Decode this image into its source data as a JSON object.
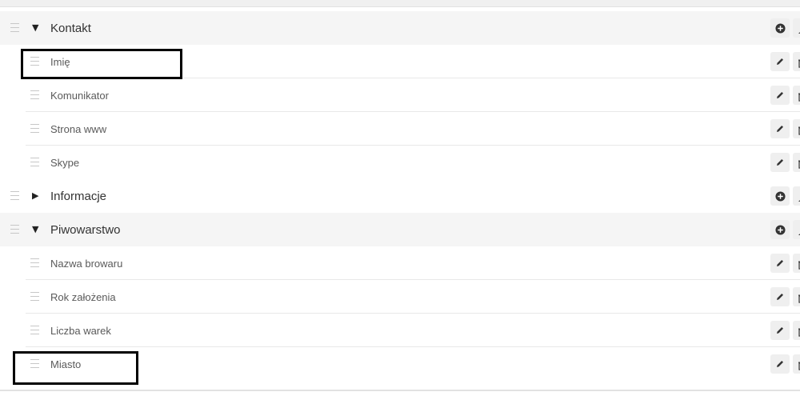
{
  "groups": [
    {
      "label": "Kontakt",
      "expanded": true,
      "toggle_icon": "▼",
      "fields": [
        {
          "label": "Imię"
        },
        {
          "label": "Komunikator"
        },
        {
          "label": "Strona www"
        },
        {
          "label": "Skype"
        }
      ]
    },
    {
      "label": "Informacje",
      "expanded": false,
      "toggle_icon": "▶",
      "fields": []
    },
    {
      "label": "Piwowarstwo",
      "expanded": true,
      "toggle_icon": "▼",
      "fields": [
        {
          "label": "Nazwa browaru"
        },
        {
          "label": "Rok założenia"
        },
        {
          "label": "Liczba warek"
        },
        {
          "label": "Miasto"
        }
      ]
    }
  ],
  "icons": {
    "drag": "drag-handle-icon",
    "group_action": "plus-circle-icon",
    "field_action": "pencil-icon",
    "second_action_group": "user-icon",
    "second_action_field": "trash-icon"
  },
  "highlight_color": "#000000"
}
